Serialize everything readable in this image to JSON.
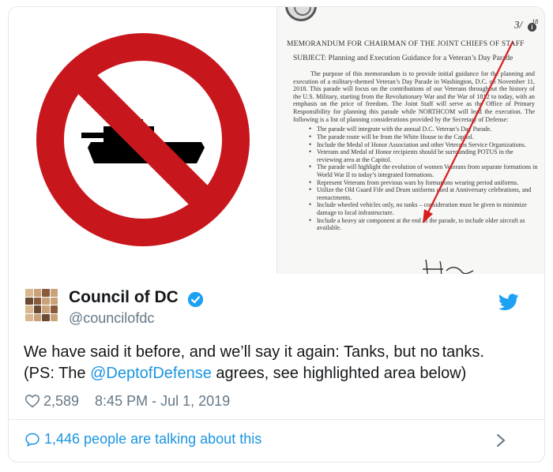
{
  "media": {
    "left_image": "no-tanks-sign",
    "memo": {
      "hand_date": "3/",
      "hand_date_tail": "18",
      "to": "MEMORANDUM FOR CHAIRMAN OF THE JOINT CHIEFS OF STAFF",
      "subject": "SUBJECT:  Planning and Execution Guidance for a Veteran’s Day Parade",
      "paragraph": "The purpose of this memorandum is to provide initial guidance for the planning and execution of a military-themed Veteran’s Day Parade in Washington, D.C. on November 11, 2018. This parade will focus on the contributions of our Veterans throughout the history of the U.S. Military, starting from the Revolutionary War and the War of 1812 to today, with an emphasis on the price of freedom. The Joint Staff will serve as the Office of Primary Responsibility for planning this parade while NORTHCOM will lead the execution. The following is a list of planning considerations provided by the Secretary of Defense:",
      "bullets": [
        "The parade will integrate with the annual D.C. Veteran’s Day Parade.",
        "The parade route will be from the White House to the Capitol.",
        "Include the Medal of Honor Association and other Veterans Service Organizations.",
        "Veterans and Medal of Honor recipients should be surrounding POTUS in the reviewing area at the Capitol.",
        "The parade will highlight the evolution of women Veterans from separate formations in World War II to today’s integrated formations.",
        "Represent Veterans from previous wars by formations wearing period uniforms.",
        "Utilize the Old Guard Fife and Drum uniforms used at Anniversary celebrations, and reenactments.",
        "Include wheeled vehicles only, no tanks – consideration must be given to minimize damage to local infrastructure.",
        "Include a heavy air component at the end of the parade, to include older aircraft as available."
      ]
    }
  },
  "author": {
    "name": "Council of DC",
    "handle": "@councilofdc"
  },
  "tweet": {
    "line1": "We have said it before, and we’ll say it again: Tanks, but no tanks.",
    "line2_pre": "(PS: The ",
    "mention": "@DeptofDefense",
    "line2_post": " agrees, see highlighted area below)"
  },
  "meta": {
    "likes": "2,589",
    "timestamp": "8:45 PM - Jul 1, 2019"
  },
  "footer": {
    "talking": "1,446 people are talking about this"
  },
  "colors": {
    "accent": "#1da1f2",
    "link": "#1b95e0",
    "muted": "#657786",
    "no_sign_red": "#c8161d"
  }
}
